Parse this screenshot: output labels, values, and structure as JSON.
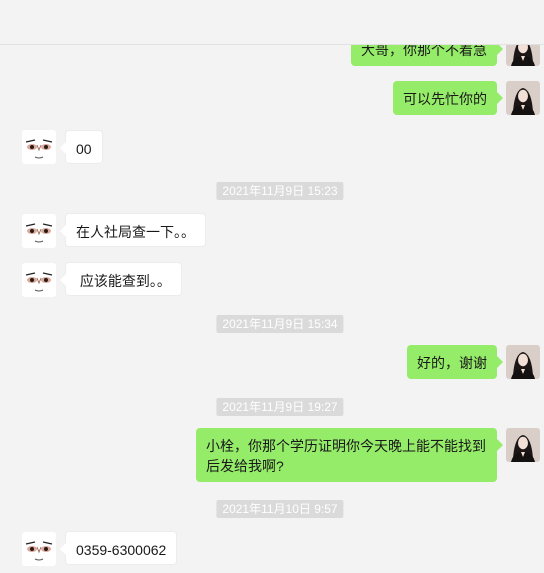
{
  "chat": {
    "colors": {
      "background": "#f3f3f3",
      "outgoing_bubble": "#95ec69",
      "incoming_bubble": "#ffffff",
      "timestamp_bg": "#dadada"
    },
    "avatars": {
      "incoming": "cartoon-face-icon",
      "outgoing": "woman-portrait-icon"
    },
    "messages": [
      {
        "type": "out",
        "text": "大哥，你那个不着急"
      },
      {
        "type": "out",
        "text": "可以先忙你的"
      },
      {
        "type": "in",
        "text": "00"
      },
      {
        "type": "time",
        "text": "2021年11月9日 15:23"
      },
      {
        "type": "in",
        "text": "在人社局查一下。。"
      },
      {
        "type": "in",
        "text": " 应该能查到。。"
      },
      {
        "type": "time",
        "text": "2021年11月9日 15:34"
      },
      {
        "type": "out",
        "text": "好的，谢谢"
      },
      {
        "type": "time",
        "text": "2021年11月9日 19:27"
      },
      {
        "type": "out",
        "text": "小栓，你那个学历证明你今天晚上能不能找到\n后发给我啊?"
      },
      {
        "type": "time",
        "text": "2021年11月10日 9:57"
      },
      {
        "type": "in",
        "text": "0359-6300062"
      }
    ]
  }
}
